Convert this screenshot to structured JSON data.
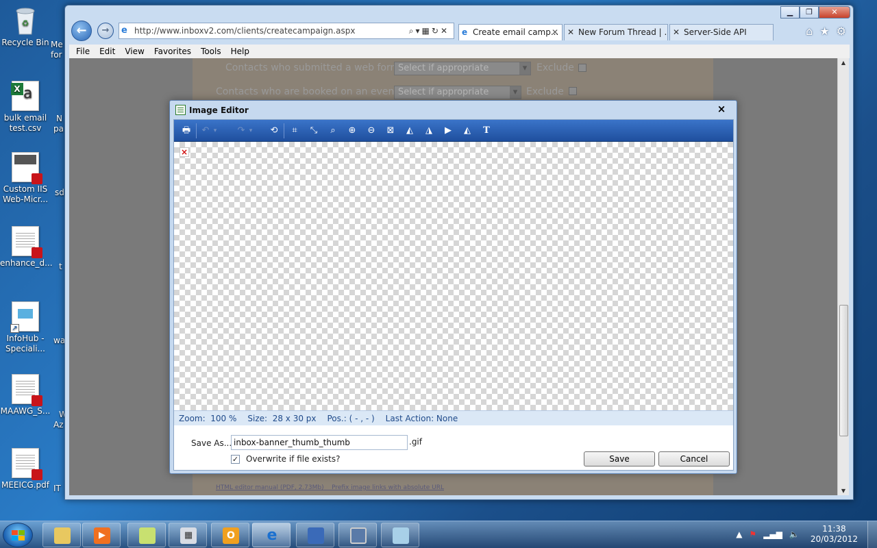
{
  "desktop": {
    "icons": [
      {
        "label": "Recycle Bin"
      },
      {
        "label": "bulk email test.csv"
      },
      {
        "label": "Custom IIS Web-Micr..."
      },
      {
        "label": "enhance_d..."
      },
      {
        "label": "InfoHub - Speciali..."
      },
      {
        "label": "MAAWG_S..."
      },
      {
        "label": "MEEICG.pdf"
      }
    ],
    "partial": [
      "Me",
      "for",
      "N",
      "pa",
      "sd",
      "t",
      "wa",
      "W",
      "Az",
      "IT"
    ]
  },
  "browser": {
    "url": "http://www.inboxv2.com/clients/createcampaign.aspx",
    "tabs": [
      {
        "title": "Create email camp...",
        "active": true
      },
      {
        "title": "New Forum Thread | ...",
        "active": false
      },
      {
        "title": "Server-Side API",
        "active": false
      }
    ],
    "menu": [
      "File",
      "Edit",
      "View",
      "Favorites",
      "Tools",
      "Help"
    ]
  },
  "page": {
    "rows": [
      {
        "label": "Contacts who submitted a web form:",
        "select": "Select if appropriate",
        "exclude": "Exclude"
      },
      {
        "label": "Contacts who are booked on an event:",
        "select": "Select if appropriate",
        "exclude": "Exclude"
      }
    ],
    "footer_link_1": "HTML editor manual (PDF, 2.73Mb)",
    "footer_link_2": "Prefix image links with absolute URL"
  },
  "dialog": {
    "title": "Image Editor",
    "close": "×",
    "status": {
      "zoom": "Zoom:  100 %",
      "size": "Size:  28 x 30 px",
      "pos": "Pos.: ( - , - )",
      "last_action": "Last Action: None"
    },
    "save_as_label": "Save As...",
    "filename": "inbox-banner_thumb_thumb",
    "extension": ".gif",
    "overwrite_label": "Overwrite if file exists?",
    "overwrite_checked": "✓",
    "save_button": "Save",
    "cancel_button": "Cancel"
  },
  "taskbar": {
    "time": "11:38",
    "date": "20/03/2012"
  }
}
